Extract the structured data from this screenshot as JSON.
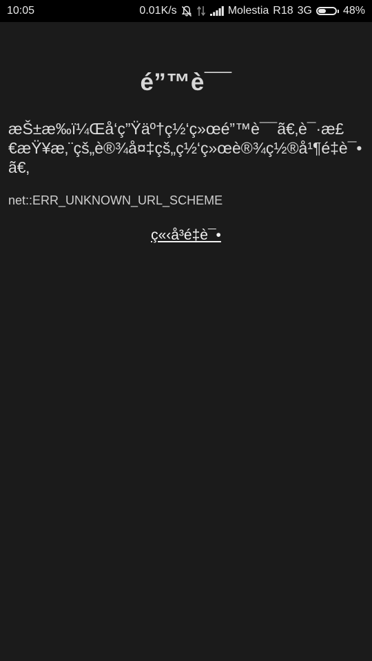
{
  "status_bar": {
    "time": "10:05",
    "net_speed": "0.01K/s",
    "carrier": "Molestia",
    "carrier_code": "R18",
    "network_type": "3G",
    "battery_percent": "48%",
    "battery_level": 0.48,
    "icons": [
      "notifications-muted-icon",
      "data-transfer-icon",
      "signal-strength-icon",
      "battery-icon"
    ]
  },
  "error_page": {
    "title": "é”™è¯¯",
    "message": "æŠ±æ‰ï¼Œå‘ç”Ÿäº†ç½‘ç»œé”™è¯¯ã€‚è¯·æ£€æŸ¥æ‚¨çš„è®¾å¤‡çš„ç½‘ç»œè®¾ç½®å¹¶é‡è¯•ã€‚",
    "error_code": "net::ERR_UNKNOWN_URL_SCHEME",
    "close_link_label": "ç«‹å³é‡è¯•"
  }
}
